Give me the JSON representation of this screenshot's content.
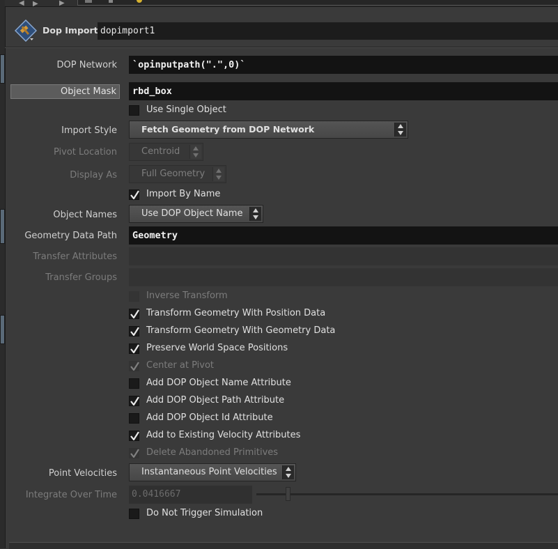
{
  "header": {
    "node_type": "Dop Import",
    "node_name": "dopimport1"
  },
  "params": {
    "dop_network": {
      "label": "DOP Network",
      "value": "`opinputpath(\".\",0)`"
    },
    "object_mask": {
      "label": "Object Mask",
      "value": "rbd_box"
    },
    "use_single_object": {
      "label": "Use Single Object",
      "checked": false
    },
    "import_style": {
      "label": "Import Style",
      "value": "Fetch Geometry from DOP Network"
    },
    "pivot_location": {
      "label": "Pivot Location",
      "value": "Centroid"
    },
    "display_as": {
      "label": "Display As",
      "value": "Full Geometry"
    },
    "import_by_name": {
      "label": "Import By Name",
      "checked": true
    },
    "object_names": {
      "label": "Object Names",
      "value": "Use DOP Object Name"
    },
    "geometry_data_path": {
      "label": "Geometry Data Path",
      "value": "Geometry"
    },
    "transfer_attributes": {
      "label": "Transfer Attributes",
      "value": ""
    },
    "transfer_groups": {
      "label": "Transfer Groups",
      "value": ""
    },
    "inverse_transform": {
      "label": "Inverse Transform",
      "checked": false
    },
    "transform_position": {
      "label": "Transform Geometry With Position Data",
      "checked": true
    },
    "transform_geometry": {
      "label": "Transform Geometry With Geometry Data",
      "checked": true
    },
    "preserve_world": {
      "label": "Preserve World Space Positions",
      "checked": true
    },
    "center_pivot": {
      "label": "Center at Pivot",
      "checked": true
    },
    "add_name_attr": {
      "label": "Add DOP Object Name Attribute",
      "checked": false
    },
    "add_path_attr": {
      "label": "Add DOP Object Path Attribute",
      "checked": true
    },
    "add_id_attr": {
      "label": "Add DOP Object Id Attribute",
      "checked": false
    },
    "add_velocity": {
      "label": "Add to Existing Velocity Attributes",
      "checked": true
    },
    "delete_abandoned": {
      "label": "Delete Abandoned Primitives",
      "checked": true
    },
    "point_velocities": {
      "label": "Point Velocities",
      "value": "Instantaneous Point Velocities"
    },
    "integrate_over_time": {
      "label": "Integrate Over Time",
      "value": "0.0416667"
    },
    "no_trigger": {
      "label": "Do Not Trigger Simulation",
      "checked": false
    }
  },
  "colors": {
    "background": "#3a3a3a",
    "field_bg": "#131313",
    "label_text": "#d0d0d0",
    "disabled_text": "#7c7c7c"
  }
}
